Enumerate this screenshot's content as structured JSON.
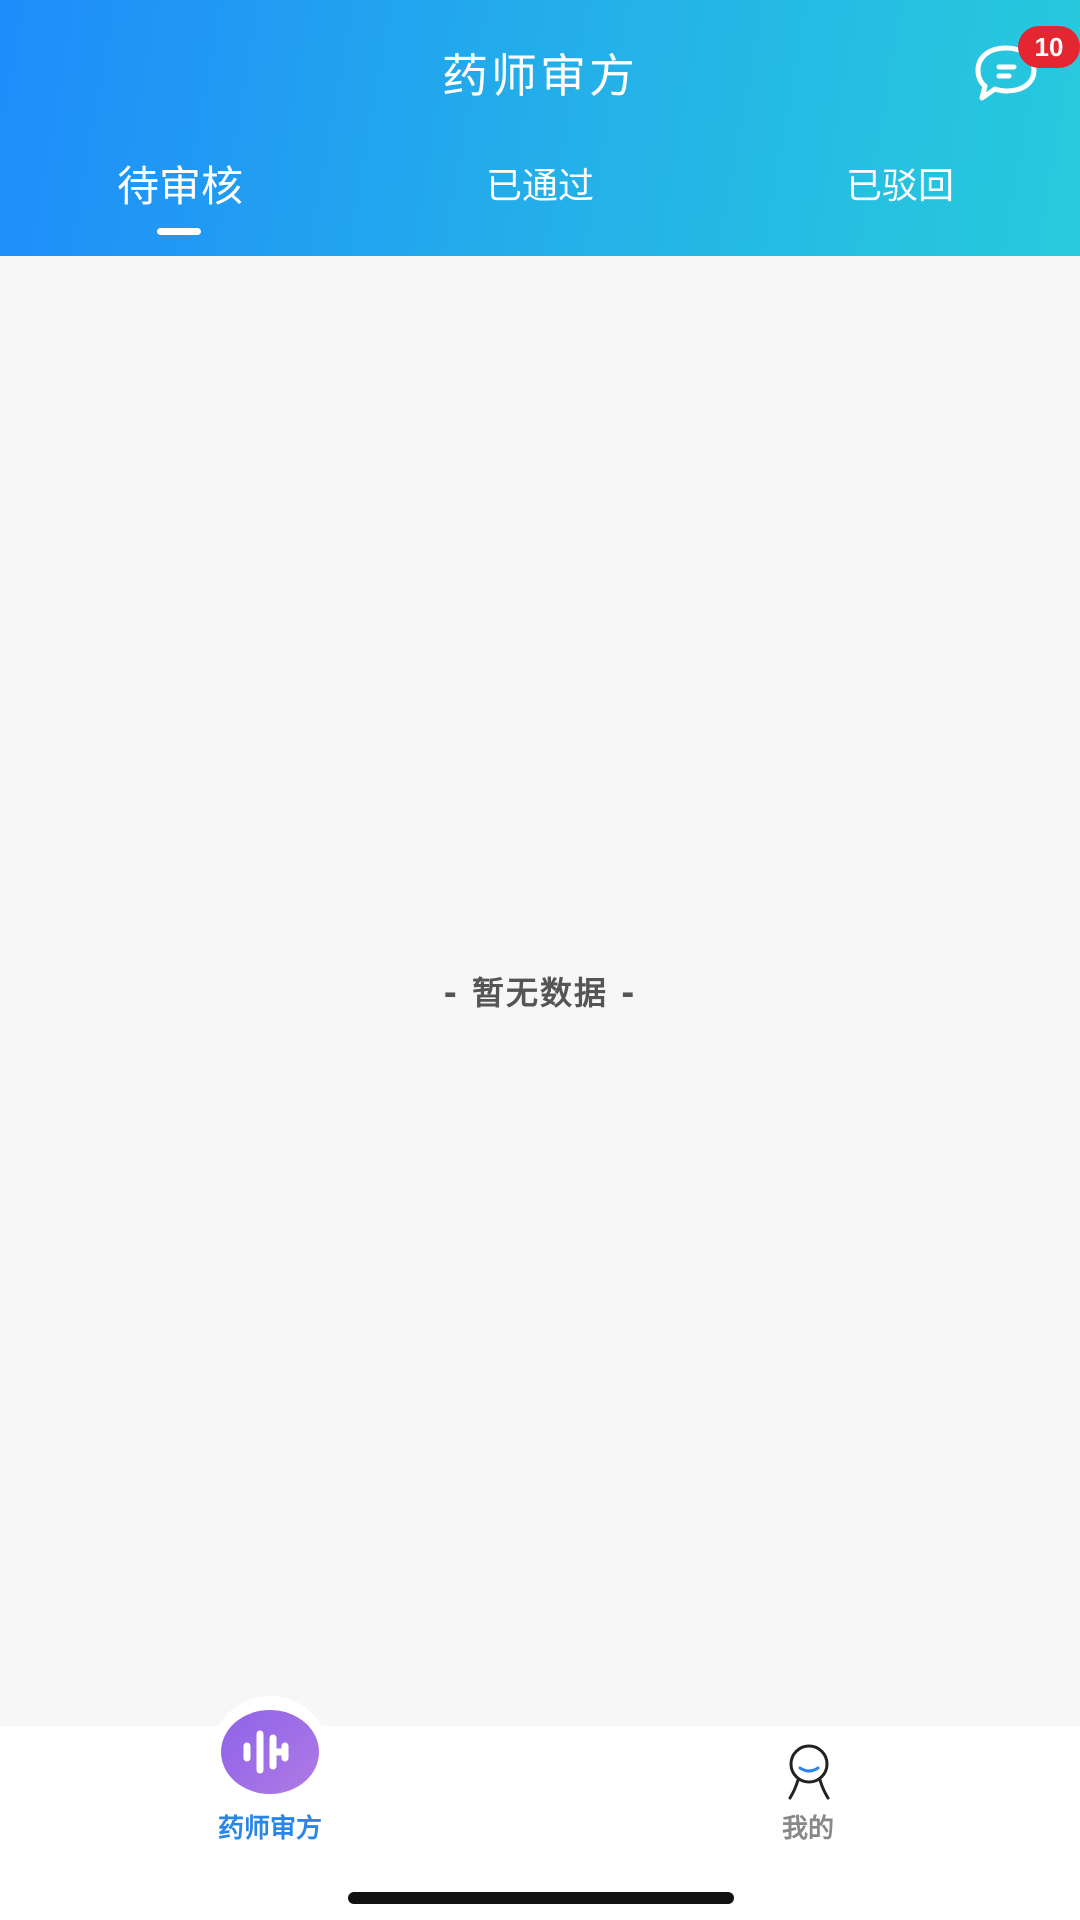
{
  "header": {
    "title": "药师审方",
    "message_badge": "10",
    "tabs": [
      {
        "label": "待审核",
        "active": true
      },
      {
        "label": "已通过",
        "active": false
      },
      {
        "label": "已驳回",
        "active": false
      }
    ]
  },
  "main": {
    "empty_text": "- 暂无数据 -"
  },
  "tabbar": {
    "items": [
      {
        "label": "药师审方",
        "icon": "waveform-icon",
        "active": true
      },
      {
        "label": "我的",
        "icon": "person-icon",
        "active": false
      }
    ]
  },
  "colors": {
    "header_gradient_start": "#1e8cfa",
    "header_gradient_end": "#27cbdc",
    "badge": "#e3262f",
    "tabbar_active": "#2a86e6",
    "tabbar_inactive": "#888888",
    "fab_gradient_start": "#8e62e8",
    "fab_gradient_end": "#b07be6"
  }
}
